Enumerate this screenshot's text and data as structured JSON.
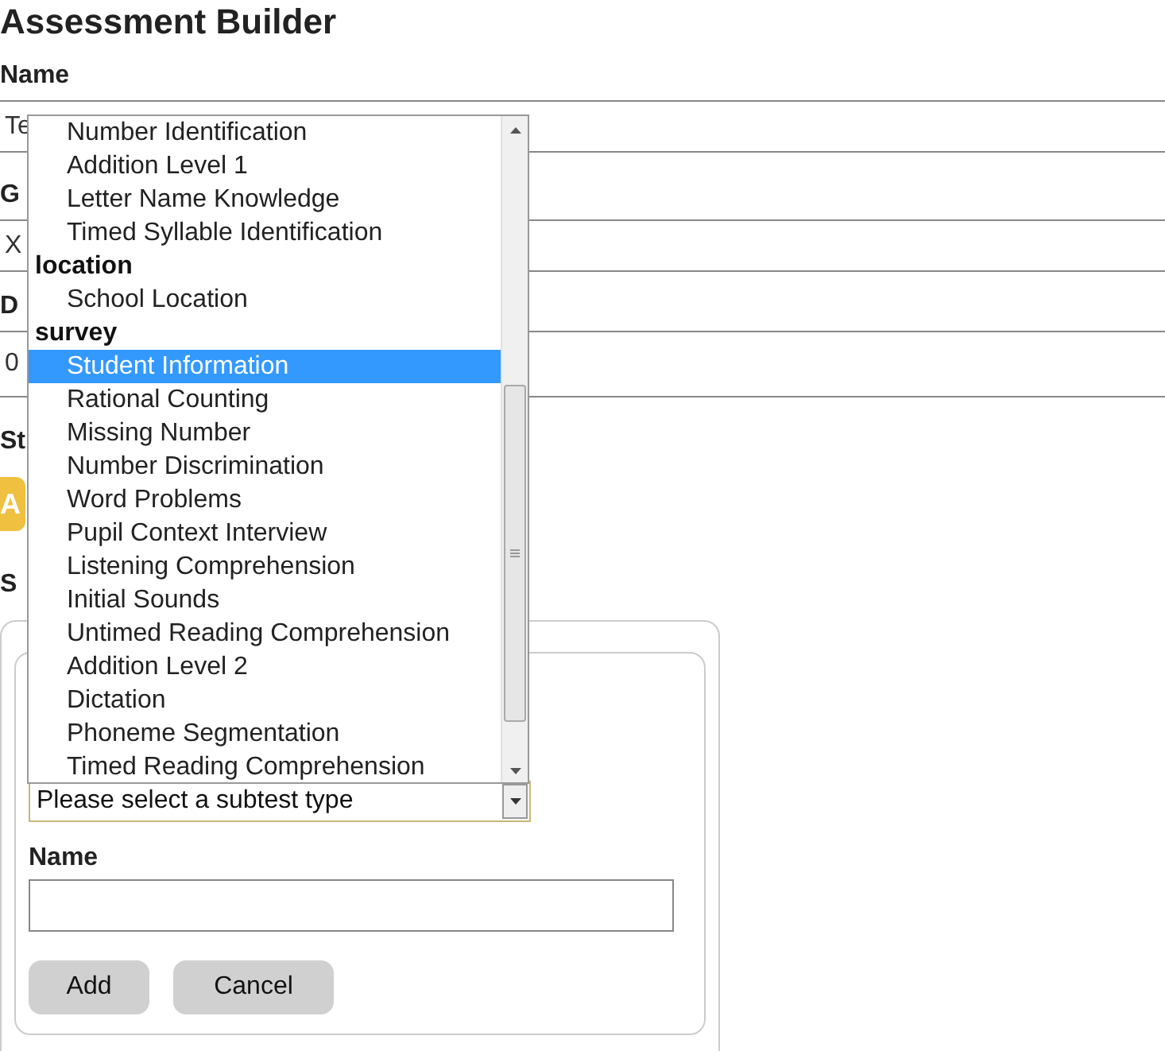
{
  "page_title": "Assessment Builder",
  "fields": [
    {
      "label": "Name",
      "value": "Te"
    },
    {
      "label": "G",
      "value": "X"
    },
    {
      "label": "D",
      "value": "0"
    }
  ],
  "status": {
    "label": "St",
    "button": "A"
  },
  "subtests_label": "S",
  "subtest_form": {
    "type_select": {
      "value": "Please select a subtest type",
      "expanded": true,
      "groups": [
        {
          "options": [
            {
              "label": "Number Identification",
              "selected": false
            },
            {
              "label": "Addition Level 1",
              "selected": false
            },
            {
              "label": "Letter Name Knowledge",
              "selected": false
            },
            {
              "label": "Timed Syllable Identification",
              "selected": false
            }
          ]
        },
        {
          "label": "location",
          "options": [
            {
              "label": "School Location",
              "selected": false
            }
          ]
        },
        {
          "label": "survey",
          "options": [
            {
              "label": "Student Information",
              "selected": true
            },
            {
              "label": "Rational Counting",
              "selected": false
            },
            {
              "label": "Missing Number",
              "selected": false
            },
            {
              "label": "Number Discrimination",
              "selected": false
            },
            {
              "label": "Word Problems",
              "selected": false
            },
            {
              "label": "Pupil Context Interview",
              "selected": false
            },
            {
              "label": "Listening Comprehension",
              "selected": false
            },
            {
              "label": "Initial Sounds",
              "selected": false
            },
            {
              "label": "Untimed Reading Comprehension",
              "selected": false
            },
            {
              "label": "Addition Level 2",
              "selected": false
            },
            {
              "label": "Dictation",
              "selected": false
            },
            {
              "label": "Phoneme Segmentation",
              "selected": false
            },
            {
              "label": "Timed Reading Comprehension",
              "selected": false
            }
          ]
        }
      ]
    },
    "name_label": "Name",
    "buttons": [
      "Add",
      "Cancel"
    ]
  }
}
